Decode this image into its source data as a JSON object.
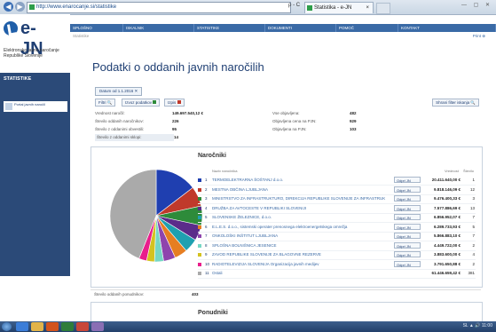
{
  "browser": {
    "url": "http://www.enarocanje.si/statistike",
    "tab_title": "Statistika - e-JN",
    "address_tools": "ρ - C"
  },
  "sidebar": {
    "logo": "e-JN",
    "tagline": "Elektronsko javno naročanje Republike Slovenije",
    "active_item": "STATISTIKE",
    "partner": "Portal javnih naročil"
  },
  "topnav": {
    "items": [
      "SPLOŠNO",
      "ISKALNIK",
      "STATISTIKE",
      "DOKUMENTI",
      "POMOČ",
      "KONTAKT"
    ]
  },
  "breadcrumb": "Statistike",
  "print_label": "Print ⊕",
  "page_title": "Podatki o oddanih javnih naročilih",
  "filter_pill": "Datum od 1.1.2016 ✕",
  "buttons": {
    "filter": "Filtri 🔍",
    "export": "Izvoz podatkov",
    "show": "Izpis",
    "save": "Shrani filter iskanja 🔍"
  },
  "stats": [
    {
      "label": "Vrednost naročil:",
      "value": "149.697.540,12 €"
    },
    {
      "label": "Število oddanih naročnikov:",
      "value": "226"
    },
    {
      "label": "Število z oddanimi obvestili:",
      "value": "95"
    },
    {
      "label": "Število z oddanimi sklopi:",
      "value": "14"
    },
    {
      "label": "Vse objavljena:",
      "value": "482"
    },
    {
      "label": "Objavljena cena na PJN:",
      "value": "929"
    },
    {
      "label": "Objavljena na PJN:",
      "value": "103"
    }
  ],
  "narocniki": {
    "title": "Naročniki",
    "headers": {
      "name": "Naziv naročnika",
      "value": "Vrednost",
      "count": "Število"
    },
    "button_label": "Odpri JN",
    "rows": [
      {
        "num": "1",
        "name": "TERMOELEKTRARNA ŠOŠTANJ d.o.o.",
        "amount": "20.411.640,00 €",
        "count": "1",
        "color": "#1f3fb0"
      },
      {
        "num": "2",
        "name": "MESTNA OBČINA LJUBLJANA",
        "amount": "9.818.146,09 €",
        "count": "12",
        "color": "#c0392b"
      },
      {
        "num": "3",
        "name": "MINISTRSTVO ZA INFRASTRUKTURO, DIREKCIJA REPUBLIKE SLOVENIJE ZA INFRASTRUKTURO",
        "amount": "9.476.400,33 €",
        "count": "3",
        "color": "#2e8b3a"
      },
      {
        "num": "4",
        "name": "DRUŽBA ZA AVTOCESTE V REPUBLIKI SLOVENIJI",
        "amount": "7.577.886,69 €",
        "count": "13",
        "color": "#5b2c8a"
      },
      {
        "num": "5",
        "name": "SLOVENSKE ŽELEZNICE, d.o.o.",
        "amount": "6.856.952,07 €",
        "count": "7",
        "color": "#1fa0b0"
      },
      {
        "num": "6",
        "name": "E.L.E.S. d.o.o., sistemski operater prenosnega elektroenergetskega omrežja",
        "amount": "6.289.733,93 €",
        "count": "5",
        "color": "#e67e22"
      },
      {
        "num": "7",
        "name": "ONKOLOŠKI INŠTITUT LJUBLJANA",
        "amount": "5.866.883,10 €",
        "count": "7",
        "color": "#8e44ad"
      },
      {
        "num": "8",
        "name": "SPLOŠNA BOLNIŠNICA JESENICE",
        "amount": "4.449.722,00 €",
        "count": "2",
        "color": "#76d7c4"
      },
      {
        "num": "9",
        "name": "ZAVOD REPUBLIKE SLOVENIJE ZA BLAGOVNE REZERVE",
        "amount": "3.883.600,00 €",
        "count": "4",
        "color": "#d4c21f"
      },
      {
        "num": "10",
        "name": "RADIOTELEVIZIJA SLOVENIJA Organizacija javnih medijev",
        "amount": "3.791.650,88 €",
        "count": "2",
        "color": "#e91e8c"
      },
      {
        "num": "11",
        "name": "Ostali",
        "amount": "61.446.659,42 €",
        "count": "381",
        "color": "#aaaaaa"
      }
    ]
  },
  "bottom_stat": {
    "label": "Število oddanih ponudnikov:",
    "value": "403"
  },
  "ponudniki_title": "Ponudniki",
  "taskbar": {
    "tray": "SL ▲ 🔊 11:00"
  },
  "chart_data": {
    "type": "pie",
    "categories": [
      "1",
      "2",
      "3",
      "4",
      "5",
      "6",
      "7",
      "8",
      "9",
      "10",
      "11"
    ],
    "values": [
      20411640.0,
      9818146.09,
      9476400.33,
      7577886.69,
      6856952.07,
      6289733.93,
      5866883.1,
      4449722.0,
      3883600.0,
      3791650.88,
      61446659.42
    ],
    "colors": [
      "#1f3fb0",
      "#c0392b",
      "#2e8b3a",
      "#5b2c8a",
      "#1fa0b0",
      "#e67e22",
      "#8e44ad",
      "#76d7c4",
      "#d4c21f",
      "#e91e8c",
      "#aaaaaa"
    ]
  }
}
